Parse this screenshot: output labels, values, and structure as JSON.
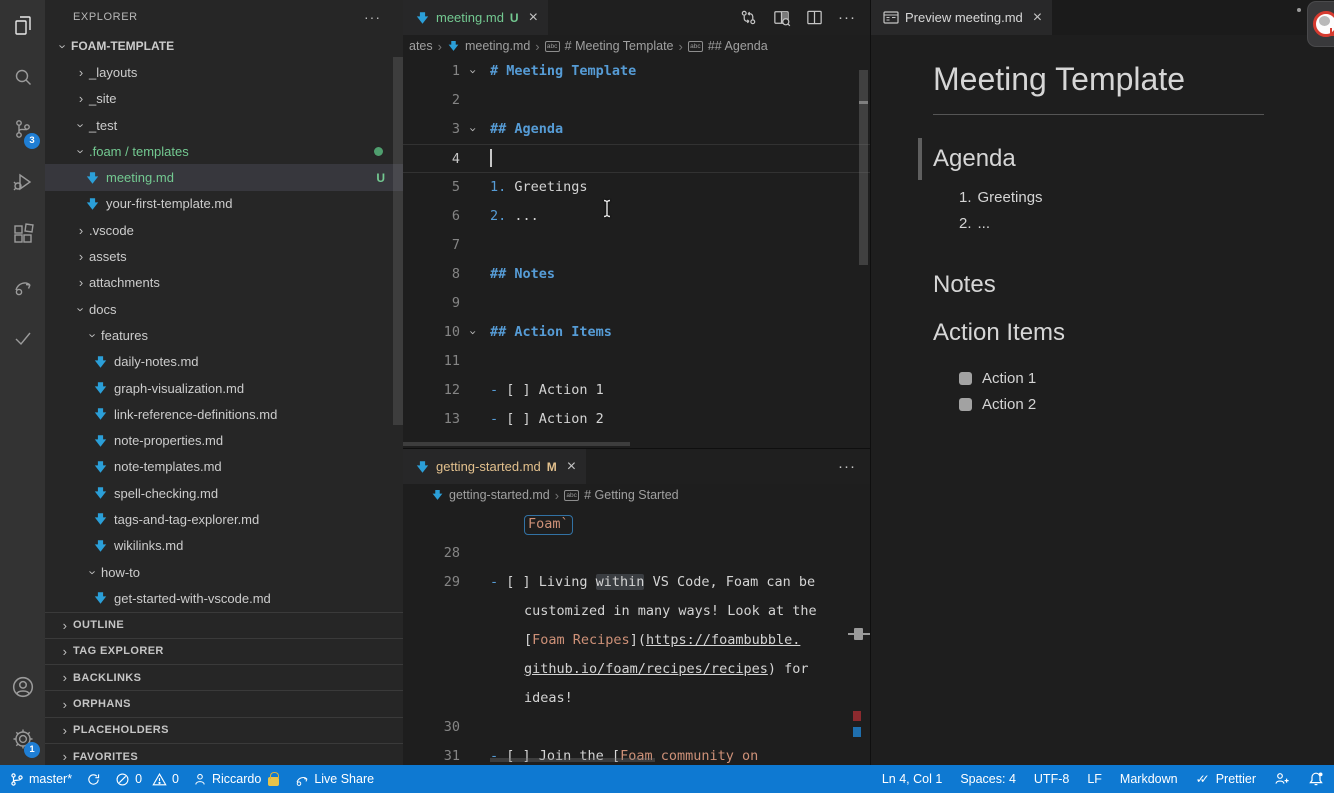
{
  "activity_bar": {
    "scm_badge": "3",
    "gear_badge": "1"
  },
  "sidebar": {
    "title": "EXPLORER",
    "more": "···",
    "root": {
      "label": "FOAM-TEMPLATE"
    },
    "tree": [
      {
        "label": "_layouts"
      },
      {
        "label": "_site"
      },
      {
        "label": "_test"
      },
      {
        "label": ".foam / templates"
      },
      {
        "label": "meeting.md",
        "badge": "U"
      },
      {
        "label": "your-first-template.md"
      },
      {
        "label": ".vscode"
      },
      {
        "label": "assets"
      },
      {
        "label": "attachments"
      },
      {
        "label": "docs"
      },
      {
        "label": "features"
      },
      {
        "label": "daily-notes.md"
      },
      {
        "label": "graph-visualization.md"
      },
      {
        "label": "link-reference-definitions.md"
      },
      {
        "label": "note-properties.md"
      },
      {
        "label": "note-templates.md"
      },
      {
        "label": "spell-checking.md"
      },
      {
        "label": "tags-and-tag-explorer.md"
      },
      {
        "label": "wikilinks.md"
      },
      {
        "label": "how-to"
      },
      {
        "label": "get-started-with-vscode.md"
      }
    ],
    "sections": [
      {
        "label": "OUTLINE"
      },
      {
        "label": "TAG EXPLORER"
      },
      {
        "label": "BACKLINKS"
      },
      {
        "label": "ORPHANS"
      },
      {
        "label": "PLACEHOLDERS"
      },
      {
        "label": "FAVORITES"
      }
    ]
  },
  "editor_top": {
    "tab": {
      "label": "meeting.md",
      "badge": "U",
      "close": "×"
    },
    "more": "···",
    "breadcrumbs": {
      "b0": "ates",
      "b1": "meeting.md",
      "b2": "# Meeting Template",
      "b3": "## Agenda",
      "abc": "abc"
    },
    "lines": {
      "l1": {
        "n": "1",
        "h": "# Meeting Template"
      },
      "l2": {
        "n": "2"
      },
      "l3": {
        "n": "3",
        "h": "## Agenda"
      },
      "l4": {
        "n": "4"
      },
      "l5": {
        "n": "5",
        "m": "1. ",
        "t": "Greetings"
      },
      "l6": {
        "n": "6",
        "m": "2. ",
        "t": "..."
      },
      "l7": {
        "n": "7"
      },
      "l8": {
        "n": "8",
        "h": "## Notes"
      },
      "l9": {
        "n": "9"
      },
      "l10": {
        "n": "10",
        "h": "## Action Items"
      },
      "l11": {
        "n": "11"
      },
      "l12": {
        "n": "12",
        "m": "- ",
        "t": "[ ] Action 1"
      },
      "l13": {
        "n": "13",
        "m": "- ",
        "t": "[ ] Action 2"
      }
    }
  },
  "editor_bottom": {
    "tab": {
      "label": "getting-started.md",
      "badge": "M",
      "close": "×"
    },
    "more": "···",
    "breadcrumbs": {
      "b1": "getting-started.md",
      "b2": "# Getting Started",
      "abc": "abc"
    },
    "pre_line": {
      "t": "Foam`"
    },
    "lines": {
      "l28": {
        "n": "28"
      },
      "l29": {
        "n": "29",
        "m": "- ",
        "t1": "[ ] Living ",
        "hl": "within",
        "t2": " VS Code, Foam can be"
      },
      "w1": {
        "t": "customized in many ways! Look at the"
      },
      "w2": {
        "t1": "[",
        "link": "Foam Recipes",
        "t2": "](",
        "url": "https://foambubble."
      },
      "w3": {
        "url": "github.io/foam/recipes/recipes",
        "t": ") for"
      },
      "w4": {
        "t": "ideas!"
      },
      "l30": {
        "n": "30"
      },
      "l31": {
        "n": "31",
        "m": "- ",
        "t1": "[ ] Join the [",
        "link": "Foam community on"
      }
    }
  },
  "preview": {
    "tab": {
      "label": "Preview meeting.md",
      "close": "×"
    },
    "h1": "Meeting Template",
    "h2_agenda": "Agenda",
    "h2_notes": "Notes",
    "h2_action_items": "Action Items",
    "list": {
      "n1": "1.",
      "i1": "Greetings",
      "n2": "2.",
      "i2": "..."
    },
    "todos": {
      "t1": "Action 1",
      "t2": "Action 2"
    }
  },
  "status_bar": {
    "branch": "master*",
    "errors": "0",
    "warnings": "0",
    "user": "Riccardo",
    "live_share": "Live Share",
    "cursor": "Ln 4, Col 1",
    "indent": "Spaces: 4",
    "encoding": "UTF-8",
    "eol": "LF",
    "language": "Markdown",
    "formatter": "Prettier"
  },
  "colors": {
    "status_bar": "#0e79d2",
    "git_untracked_green": "#73c991",
    "git_modified_yellow": "#e2c08d",
    "heading_blue": "#569cd6",
    "string_orange": "#ce9178",
    "badge_blue": "#1f7ed4"
  }
}
